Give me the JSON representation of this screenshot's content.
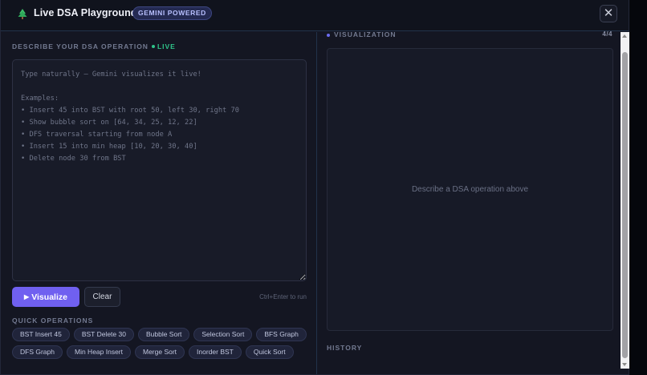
{
  "header": {
    "title": "Live DSA Playground",
    "badge": "GEMINI POWERED",
    "close_symbol": "✕"
  },
  "input_section": {
    "label": "DESCRIBE YOUR DSA OPERATION",
    "live_label": "LIVE",
    "placeholder": "Type naturally — Gemini visualizes it live!\n\nExamples:\n• Insert 45 into BST with root 50, left 30, right 70\n• Show bubble sort on [64, 34, 25, 12, 22]\n• DFS traversal starting from node A\n• Insert 15 into min heap [10, 20, 30, 40]\n• Delete node 30 from BST",
    "value": ""
  },
  "actions": {
    "visualize_label": "Visualize",
    "visualize_icon": "▶",
    "clear_label": "Clear",
    "shortcut_hint": "Ctrl+Enter to run"
  },
  "quick_operations": {
    "label": "QUICK OPERATIONS",
    "rows": [
      [
        "BST Insert 45",
        "BST Delete 30",
        "Bubble Sort",
        "Selection Sort",
        "BFS Graph"
      ],
      [
        "DFS Graph",
        "Min Heap Insert",
        "Merge Sort",
        "Inorder BST",
        "Quick Sort"
      ]
    ]
  },
  "visualization": {
    "label": "VISUALIZATION",
    "counter": "4/4",
    "empty_message": "Describe a DSA operation above"
  },
  "history": {
    "label": "HISTORY"
  },
  "colors": {
    "accent": "#7060f0",
    "live": "#2fc48a",
    "background": "#141622"
  },
  "icons": {
    "logo": "tree-icon",
    "close": "close-icon",
    "play": "play-icon"
  }
}
